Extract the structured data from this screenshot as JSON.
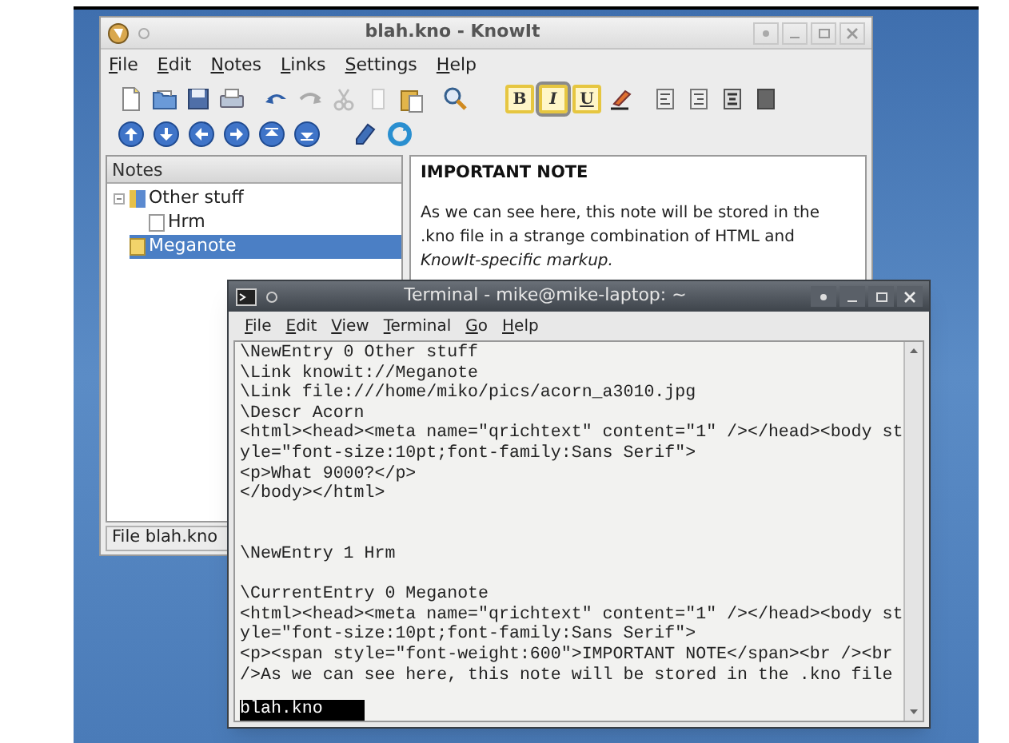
{
  "knowit_window": {
    "title": "blah.kno - KnowIt",
    "menu": [
      "File",
      "Edit",
      "Notes",
      "Links",
      "Settings",
      "Help"
    ],
    "format_buttons": [
      {
        "label": "B",
        "on": false
      },
      {
        "label": "I",
        "on": true
      },
      {
        "label": "U",
        "on": false
      }
    ],
    "tree": {
      "header": "Notes",
      "items": [
        {
          "label": "Other stuff",
          "expanded": true,
          "selected": false,
          "children": [
            {
              "label": "Hrm",
              "selected": false
            }
          ]
        },
        {
          "label": "Meganote",
          "selected": true
        }
      ]
    },
    "note": {
      "heading": "IMPORTANT NOTE",
      "body": "As we can see here, this note will be stored in the .kno file in a strange combination of HTML and *KnowIt-specific markup.*"
    },
    "status_bar": "File blah.kno"
  },
  "terminal_window": {
    "title": "Terminal - mike@mike-laptop: ~",
    "menu": [
      "File",
      "Edit",
      "View",
      "Terminal",
      "Go",
      "Help"
    ],
    "output": "\\NewEntry 0 Other stuff\n\\Link knowit://Meganote\n\\Link file:///home/miko/pics/acorn_a3010.jpg\n\\Descr Acorn\n<html><head><meta name=\"qrichtext\" content=\"1\" /></head><body st\nyle=\"font-size:10pt;font-family:Sans Serif\">\n<p>What 9000?</p>\n</body></html>\n\n\n\\NewEntry 1 Hrm\n\n\\CurrentEntry 0 Meganote\n<html><head><meta name=\"qrichtext\" content=\"1\" /></head><body st\nyle=\"font-size:10pt;font-family:Sans Serif\">\n<p><span style=\"font-weight:600\">IMPORTANT NOTE</span><br /><br\n/>As we can see here, this note will be stored in the .kno file",
    "selection": "blah.kno"
  }
}
